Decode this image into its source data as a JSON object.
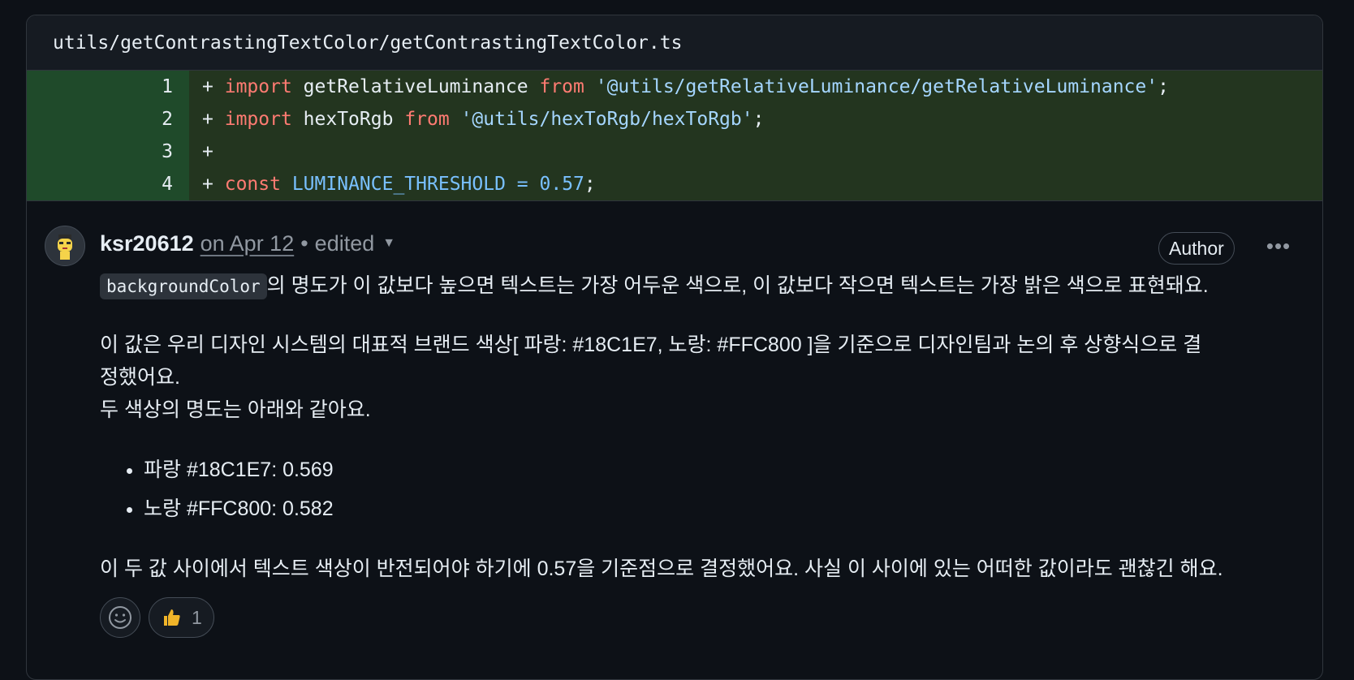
{
  "file": {
    "path": "utils/getContrastingTextColor/getContrastingTextColor.ts"
  },
  "diff": {
    "lines": [
      {
        "num": "1"
      },
      {
        "num": "2"
      },
      {
        "num": "3"
      },
      {
        "num": "4"
      }
    ],
    "tokens": {
      "plus": "+",
      "import": "import",
      "from": "from",
      "const": "const",
      "l1_name": "getRelativeLuminance",
      "l1_path": "'@utils/getRelativeLuminance/getRelativeLuminance'",
      "l2_name": "hexToRgb",
      "l2_path": "'@utils/hexToRgb/hexToRgb'",
      "l4_name": "LUMINANCE_THRESHOLD",
      "l4_eq": "=",
      "l4_val": "0.57",
      "semi": ";"
    }
  },
  "comment": {
    "author": "ksr20612",
    "date": "on Apr 12",
    "separator": "•",
    "edited": "edited",
    "badge": "Author",
    "code_word": "backgroundColor",
    "p1_rest": "의 명도가 이 값보다 높으면 텍스트는 가장 어두운 색으로, 이 값보다 작으면 텍스트는 가장 밝은 색으로 표현돼요.",
    "p2_line1": "이 값은 우리 디자인 시스템의 대표적 브랜드 색상[ 파랑: #18C1E7, 노랑: #FFC800 ]을 기준으로 디자인팀과 논의 후 상향식으로 결",
    "p2_line2": "정했어요.",
    "p2_line3": "두 색상의 명도는 아래와 같아요.",
    "list": [
      "파랑 #18C1E7: 0.569",
      "노랑 #FFC800: 0.582"
    ],
    "p3": "이 두 값 사이에서 텍스트 색상이 반전되어야 하기에 0.57을 기준점으로 결정했어요. 사실 이 사이에 있는 어떠한 값이라도 괜찮긴 해요.",
    "reactions": {
      "thumbs_count": "1"
    }
  },
  "colors": {
    "background": "#0d1117",
    "added_line": "#23351f",
    "keyword": "#ff7b72",
    "string": "#a5d6ff",
    "constant": "#79c0ff"
  }
}
